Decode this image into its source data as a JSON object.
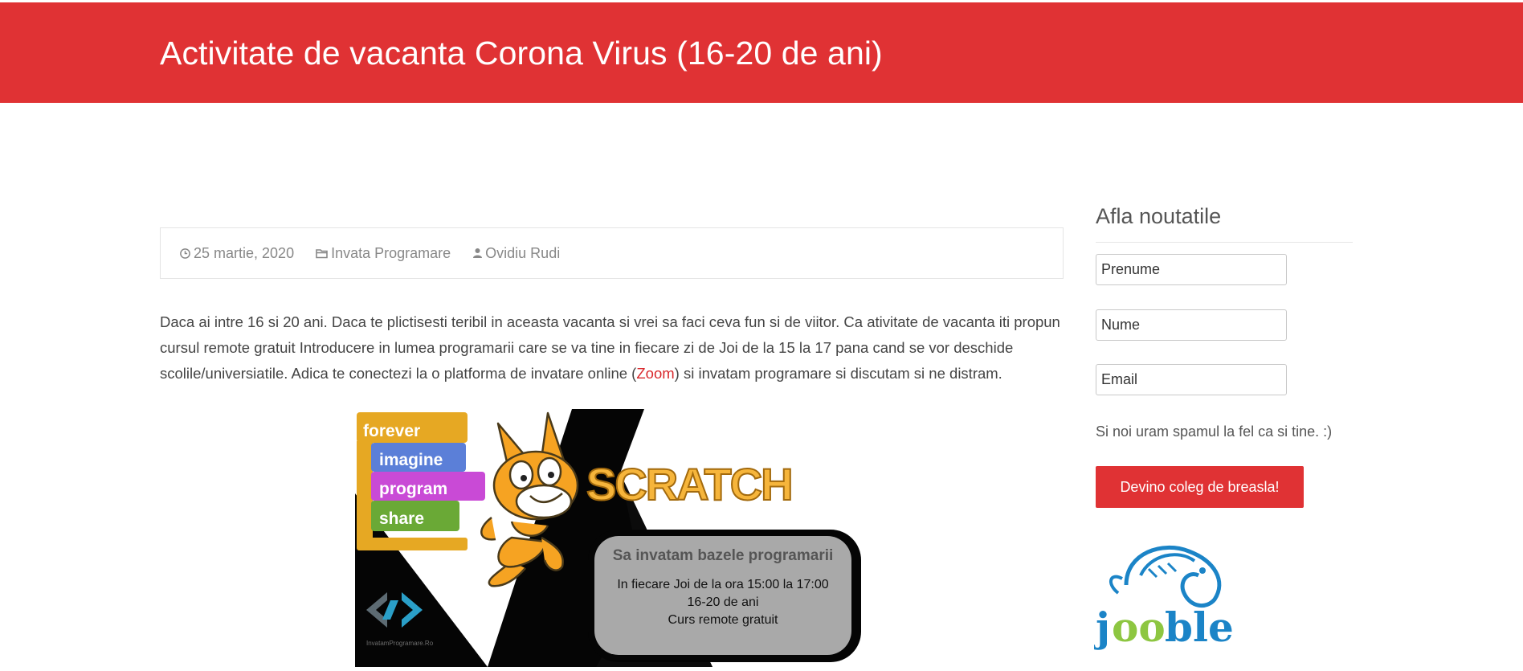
{
  "page": {
    "title": "Activitate de vacanta Corona Virus (16-20 de ani)"
  },
  "meta": {
    "date": "25 martie, 2020",
    "category": "Invata Programare",
    "author": "Ovidiu Rudi"
  },
  "article": {
    "paragraph_before_link": "Daca ai intre 16 si 20 ani. Daca te plictisesti teribil in aceasta vacanta si vrei sa faci ceva fun si de viitor. Ca ativitate de vacanta iti propun cursul remote gratuit Introducere in lumea programarii care se va tine in fiecare zi de Joi de la 15 la 17 pana cand se vor deschide scolile/universiatile. Adica te conectezi la o platforma de invatare online (",
    "link_text": "Zoom",
    "paragraph_after_link": ") si invatam programare si discutam si ne distram."
  },
  "hero": {
    "blocks": [
      "forever",
      "imagine",
      "program",
      "share"
    ],
    "brand": "SCRATCH",
    "card_title": "Sa invatam bazele programarii",
    "card_lines": [
      "In fiecare Joi de la ora 15:00 la 17:00",
      "16-20 de ani",
      "Curs remote gratuit"
    ],
    "logo_caption": "InvatamProgramare.Ro"
  },
  "sidebar": {
    "title": "Afla noutatile",
    "first_name_placeholder": "Prenume",
    "last_name_placeholder": "Nume",
    "email_placeholder": "Email",
    "spam_note": "Si noi uram spamul la fel ca si tine. :)",
    "button_label": "Devino coleg de breasla!",
    "sponsor_logo": "jooble"
  },
  "colors": {
    "brand_red": "#e03234",
    "link_red": "#d9282c",
    "jooble_blue": "#1b84c7",
    "jooble_green": "#8dc641"
  }
}
